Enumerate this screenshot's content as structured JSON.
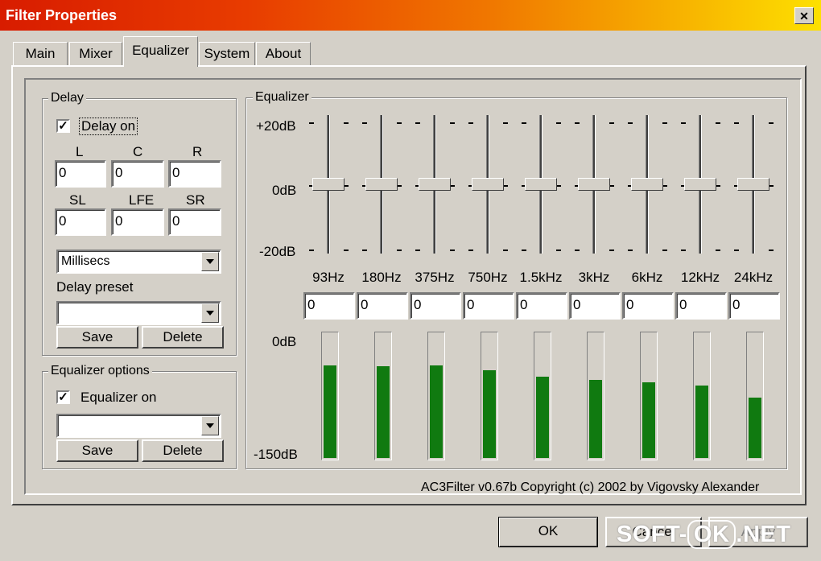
{
  "window": {
    "title": "Filter Properties",
    "close": "✕"
  },
  "tabs": [
    "Main",
    "Mixer",
    "Equalizer",
    "System",
    "About"
  ],
  "delay": {
    "group_title": "Delay",
    "checkbox_label": "Delay on",
    "checked": true,
    "channels_row1": [
      {
        "label": "L",
        "value": "0"
      },
      {
        "label": "C",
        "value": "0"
      },
      {
        "label": "R",
        "value": "0"
      }
    ],
    "channels_row2": [
      {
        "label": "SL",
        "value": "0"
      },
      {
        "label": "LFE",
        "value": "0"
      },
      {
        "label": "SR",
        "value": "0"
      }
    ],
    "units_value": "Millisecs",
    "preset_label": "Delay preset",
    "preset_value": "",
    "save_label": "Save",
    "delete_label": "Delete"
  },
  "eq_options": {
    "group_title": "Equalizer options",
    "checkbox_label": "Equalizer on",
    "checked": true,
    "preset_value": "",
    "save_label": "Save",
    "delete_label": "Delete"
  },
  "equalizer": {
    "group_title": "Equalizer",
    "db_top": "+20dB",
    "db_mid": "0dB",
    "db_bottom": "-20dB",
    "meter_top": "0dB",
    "meter_bottom": "-150dB",
    "bands": [
      {
        "freq": "93Hz",
        "value": "0",
        "level": 0.74
      },
      {
        "freq": "180Hz",
        "value": "0",
        "level": 0.73
      },
      {
        "freq": "375Hz",
        "value": "0",
        "level": 0.74
      },
      {
        "freq": "750Hz",
        "value": "0",
        "level": 0.7
      },
      {
        "freq": "1.5kHz",
        "value": "0",
        "level": 0.65
      },
      {
        "freq": "3kHz",
        "value": "0",
        "level": 0.62
      },
      {
        "freq": "6kHz",
        "value": "0",
        "level": 0.6
      },
      {
        "freq": "12kHz",
        "value": "0",
        "level": 0.58
      },
      {
        "freq": "24kHz",
        "value": "0",
        "level": 0.48
      }
    ]
  },
  "copyright": "AC3Filter v0.67b Copyright (c) 2002 by Vigovsky Alexander",
  "buttons": {
    "ok": "OK",
    "cancel": "Cancel",
    "apply": "Apply"
  },
  "watermark": {
    "pre": "SOFT-",
    "ok": "OK",
    "post": ".NET"
  },
  "colors": {
    "meter_fill": "#107a10",
    "title_start": "#d81c00",
    "title_end": "#fde000"
  }
}
